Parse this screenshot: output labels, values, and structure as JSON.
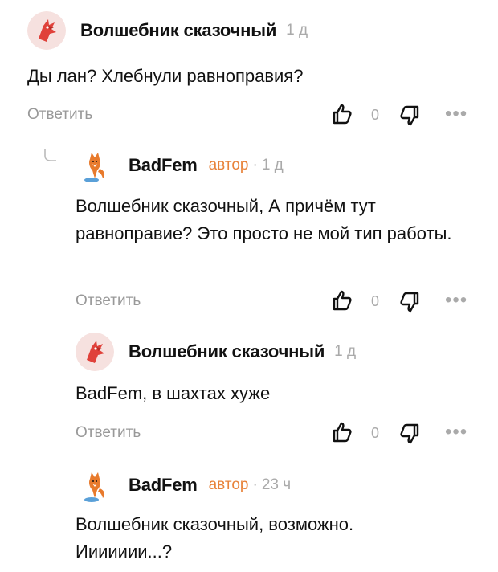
{
  "comments": [
    {
      "author": "Волшебник сказочный",
      "badge": "",
      "time": "1 д",
      "text": "Ды лан? Хлебнули равноправия?",
      "reply_label": "Ответить",
      "likes": "0",
      "avatar": "red-bird-avatar"
    },
    {
      "author": "BadFem",
      "badge": "автор",
      "time": "1 д",
      "text": "Волшебник сказочный, А причём тут равноправие? Это просто не мой тип работы.",
      "reply_label": "Ответить",
      "likes": "0",
      "avatar": "fox-avatar"
    },
    {
      "author": "Волшебник сказочный",
      "badge": "",
      "time": "1 д",
      "text": "BadFem, в шахтах хуже",
      "reply_label": "Ответить",
      "likes": "0",
      "avatar": "red-bird-avatar"
    },
    {
      "author": "BadFem",
      "badge": "автор",
      "time": "23 ч",
      "text": "Волшебник сказочный, возможно. Иииииии...?",
      "reply_label": "",
      "likes": "",
      "avatar": "fox-avatar"
    }
  ],
  "colors": {
    "author_badge": "#e8833a",
    "muted": "#999999",
    "bird": "#e0413a"
  }
}
